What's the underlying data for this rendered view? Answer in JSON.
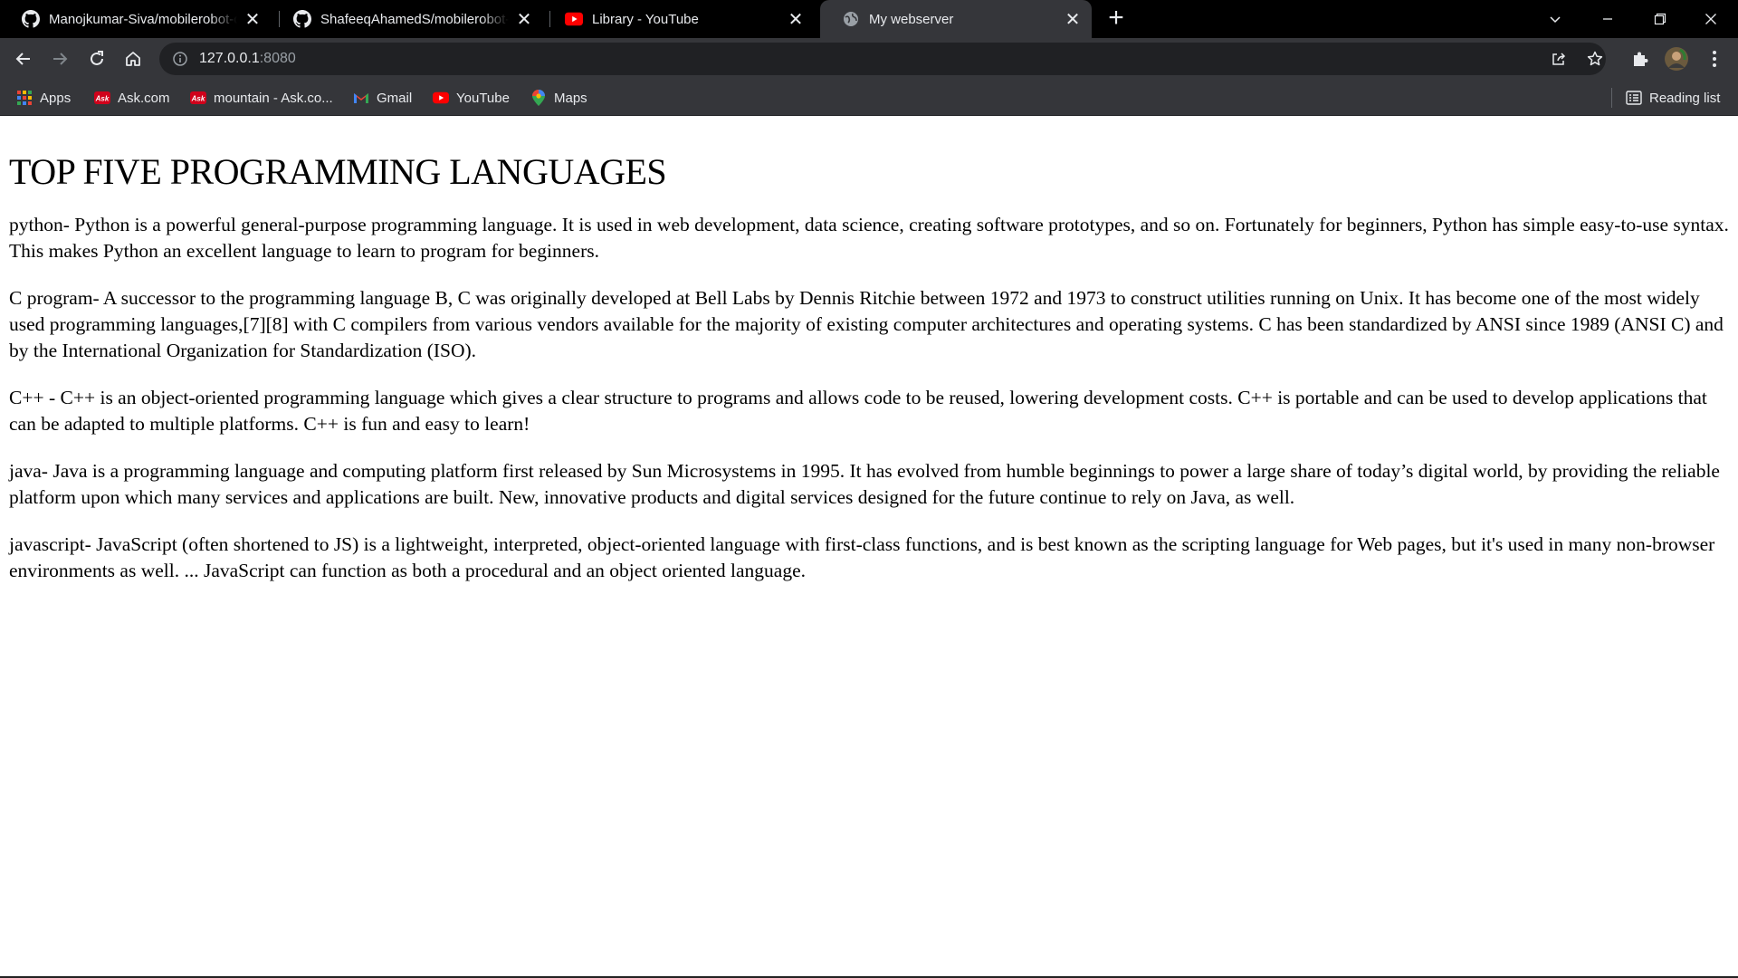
{
  "tabs": [
    {
      "title": "Manojkumar-Siva/mobilerobot-c",
      "icon": "github-icon",
      "active": false
    },
    {
      "title": "ShafeeqAhamedS/mobilerobot-c",
      "icon": "github-icon",
      "active": false
    },
    {
      "title": "Library - YouTube",
      "icon": "youtube-icon",
      "active": false
    },
    {
      "title": "My webserver",
      "icon": "globe-icon",
      "active": true
    }
  ],
  "toolbar": {
    "url_host": "127.0.0.1",
    "url_port": ":8080"
  },
  "bookmarks": [
    {
      "label": "Apps",
      "icon": "apps-grid-icon"
    },
    {
      "label": "Ask.com",
      "icon": "ask-icon"
    },
    {
      "label": "mountain - Ask.co...",
      "icon": "ask-icon"
    },
    {
      "label": "Gmail",
      "icon": "gmail-icon"
    },
    {
      "label": "YouTube",
      "icon": "youtube-icon"
    },
    {
      "label": "Maps",
      "icon": "maps-icon"
    }
  ],
  "reading_list": {
    "label": "Reading list"
  },
  "page": {
    "heading": "TOP FIVE PROGRAMMING LANGUAGES",
    "paragraphs": [
      "python- Python is a powerful general-purpose programming language. It is used in web development, data science, creating software prototypes, and so on. Fortunately for beginners, Python has simple easy-to-use syntax. This makes Python an excellent language to learn to program for beginners.",
      "C program- A successor to the programming language B, C was originally developed at Bell Labs by Dennis Ritchie between 1972 and 1973 to construct utilities running on Unix. It has become one of the most widely used programming languages,[7][8] with C compilers from various vendors available for the majority of existing computer architectures and operating systems. C has been standardized by ANSI since 1989 (ANSI C) and by the International Organization for Standardization (ISO).",
      "C++ - C++ is an object-oriented programming language which gives a clear structure to programs and allows code to be reused, lowering development costs. C++ is portable and can be used to develop applications that can be adapted to multiple platforms. C++ is fun and easy to learn!",
      "java- Java is a programming language and computing platform first released by Sun Microsystems in 1995. It has evolved from humble beginnings to power a large share of today’s digital world, by providing the reliable platform upon which many services and applications are built. New, innovative products and digital services designed for the future continue to rely on Java, as well.",
      "javascript- JavaScript (often shortened to JS) is a lightweight, interpreted, object-oriented language with first-class functions, and is best known as the scripting language for Web pages, but it's used in many non-browser environments as well. ... JavaScript can function as both a procedural and an object oriented language."
    ]
  },
  "colors": {
    "tab_strip": "#000000",
    "toolbar": "#35363a",
    "omnibox": "#202124",
    "page_background": "#ffffff",
    "youtube_red": "#ff0000"
  }
}
